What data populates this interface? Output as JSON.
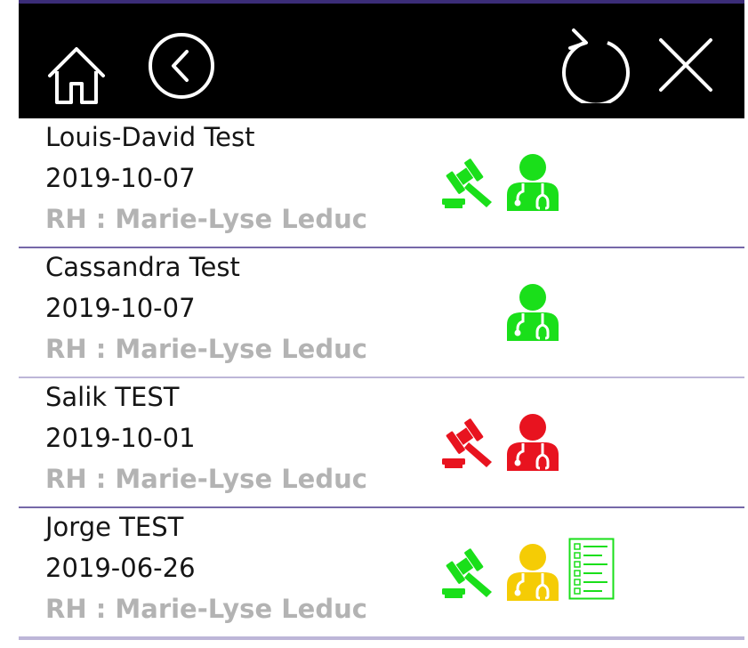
{
  "header": {
    "home_icon": "home-icon",
    "back_icon": "back-circle-icon",
    "refresh_icon": "refresh-icon",
    "close_icon": "close-icon"
  },
  "colors": {
    "green": "#1adf1a",
    "red": "#e8131f",
    "yellow": "#f5cc05",
    "topbar": "#000000",
    "muted_text": "#b3b3b3",
    "divider": "#7668a8"
  },
  "employees": [
    {
      "name": "Louis-David Test",
      "date": "2019-10-07",
      "rh": "RH : Marie-Lyse Leduc",
      "icons": [
        {
          "type": "gavel-icon",
          "status": "green"
        },
        {
          "type": "doctor-icon",
          "status": "green"
        }
      ]
    },
    {
      "name": "Cassandra Test",
      "date": "2019-10-07",
      "rh": "RH : Marie-Lyse Leduc",
      "icons": [
        {
          "type": "doctor-icon",
          "status": "green"
        }
      ]
    },
    {
      "name": "Salik TEST",
      "date": "2019-10-01",
      "rh": "RH : Marie-Lyse Leduc",
      "icons": [
        {
          "type": "gavel-icon",
          "status": "red"
        },
        {
          "type": "doctor-icon",
          "status": "red"
        }
      ]
    },
    {
      "name": "Jorge TEST",
      "date": "2019-06-26",
      "rh": "RH : Marie-Lyse Leduc",
      "icons": [
        {
          "type": "gavel-icon",
          "status": "green"
        },
        {
          "type": "doctor-icon",
          "status": "yellow"
        },
        {
          "type": "checklist-icon",
          "status": "green"
        }
      ]
    }
  ]
}
